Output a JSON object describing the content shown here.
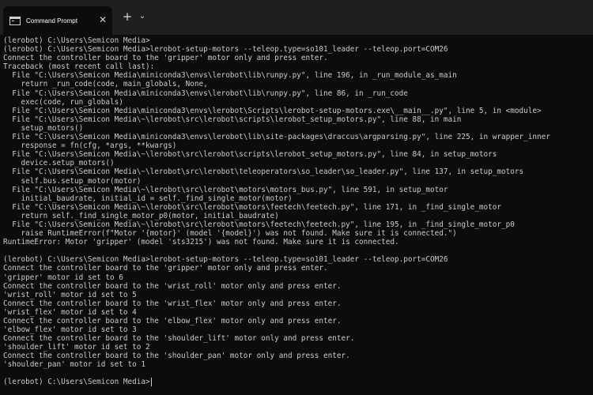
{
  "window": {
    "tab_title": "Command Prompt",
    "close_glyph": "✕",
    "new_tab_glyph": "+",
    "dropdown_glyph": "⌄"
  },
  "terminal": {
    "lines": [
      "(lerobot) C:\\Users\\Semicon Media>",
      "(lerobot) C:\\Users\\Semicon Media>lerobot-setup-motors --teleop.type=so101_leader --teleop.port=COM26",
      "Connect the controller board to the 'gripper' motor only and press enter.",
      "Traceback (most recent call last):",
      "  File \"C:\\Users\\Semicon Media\\miniconda3\\envs\\lerobot\\lib\\runpy.py\", line 196, in _run_module_as_main",
      "    return _run_code(code, main_globals, None,",
      "  File \"C:\\Users\\Semicon Media\\miniconda3\\envs\\lerobot\\lib\\runpy.py\", line 86, in _run_code",
      "    exec(code, run_globals)",
      "  File \"C:\\Users\\Semicon Media\\miniconda3\\envs\\lerobot\\Scripts\\lerobot-setup-motors.exe\\__main__.py\", line 5, in <module>",
      "  File \"C:\\Users\\Semicon Media\\~\\lerobot\\src\\lerobot\\scripts\\lerobot_setup_motors.py\", line 88, in main",
      "    setup_motors()",
      "  File \"C:\\Users\\Semicon Media\\miniconda3\\envs\\lerobot\\lib\\site-packages\\draccus\\argparsing.py\", line 225, in wrapper_inner",
      "    response = fn(cfg, *args, **kwargs)",
      "  File \"C:\\Users\\Semicon Media\\~\\lerobot\\src\\lerobot\\scripts\\lerobot_setup_motors.py\", line 84, in setup_motors",
      "    device.setup_motors()",
      "  File \"C:\\Users\\Semicon Media\\~\\lerobot\\src\\lerobot\\teleoperators\\so_leader\\so_leader.py\", line 137, in setup_motors",
      "    self.bus.setup_motor(motor)",
      "  File \"C:\\Users\\Semicon Media\\~\\lerobot\\src\\lerobot\\motors\\motors_bus.py\", line 591, in setup_motor",
      "    initial_baudrate, initial_id = self._find_single_motor(motor)",
      "  File \"C:\\Users\\Semicon Media\\~\\lerobot\\src\\lerobot\\motors\\feetech\\feetech.py\", line 171, in _find_single_motor",
      "    return self._find_single_motor_p0(motor, initial_baudrate)",
      "  File \"C:\\Users\\Semicon Media\\~\\lerobot\\src\\lerobot\\motors\\feetech\\feetech.py\", line 195, in _find_single_motor_p0",
      "    raise RuntimeError(f\"Motor '{motor}' (model '{model}') was not found. Make sure it is connected.\")",
      "RuntimeError: Motor 'gripper' (model 'sts3215') was not found. Make sure it is connected.",
      "",
      "(lerobot) C:\\Users\\Semicon Media>lerobot-setup-motors --teleop.type=so101_leader --teleop.port=COM26",
      "Connect the controller board to the 'gripper' motor only and press enter.",
      "'gripper' motor id set to 6",
      "Connect the controller board to the 'wrist_roll' motor only and press enter.",
      "'wrist_roll' motor id set to 5",
      "Connect the controller board to the 'wrist_flex' motor only and press enter.",
      "'wrist_flex' motor id set to 4",
      "Connect the controller board to the 'elbow_flex' motor only and press enter.",
      "'elbow_flex' motor id set to 3",
      "Connect the controller board to the 'shoulder_lift' motor only and press enter.",
      "'shoulder_lift' motor id set to 2",
      "Connect the controller board to the 'shoulder_pan' motor only and press enter.",
      "'shoulder_pan' motor id set to 1"
    ],
    "prompt": "(lerobot) C:\\Users\\Semicon Media>"
  },
  "colors": {
    "background": "#0c0c0c",
    "titlebar": "#1f1f1f",
    "text": "#cccccc"
  }
}
